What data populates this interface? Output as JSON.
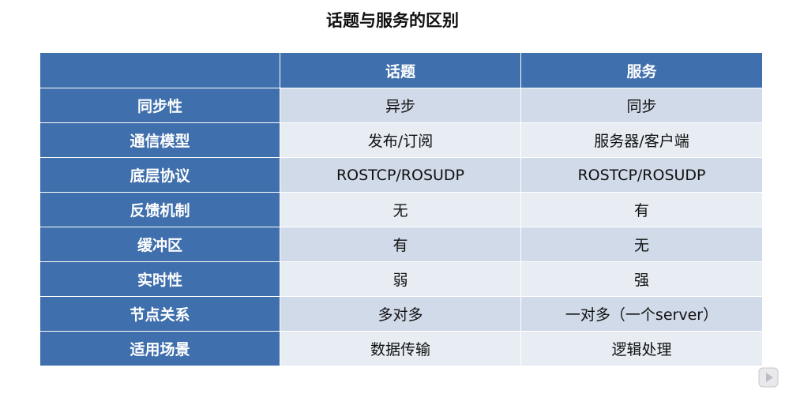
{
  "title": "话题与服务的区别",
  "table": {
    "headers": [
      "",
      "话题",
      "服务"
    ],
    "rows": [
      {
        "label": "同步性",
        "topic": "异步",
        "service": "同步"
      },
      {
        "label": "通信模型",
        "topic": "发布/订阅",
        "service": "服务器/客户端"
      },
      {
        "label": "底层协议",
        "topic": "ROSTCP/ROSUDP",
        "service": "ROSTCP/ROSUDP"
      },
      {
        "label": "反馈机制",
        "topic": "无",
        "service": "有"
      },
      {
        "label": "缓冲区",
        "topic": "有",
        "service": "无"
      },
      {
        "label": "实时性",
        "topic": "弱",
        "service": "强"
      },
      {
        "label": "节点关系",
        "topic": "多对多",
        "service": "一对多（一个server）"
      },
      {
        "label": "适用场景",
        "topic": "数据传输",
        "service": "逻辑处理"
      }
    ]
  },
  "colors": {
    "header_bg": "#3f6fac",
    "row_odd_bg": "#d1dae8",
    "row_even_bg": "#e8edf4"
  },
  "icons": {
    "corner": "play-icon"
  }
}
